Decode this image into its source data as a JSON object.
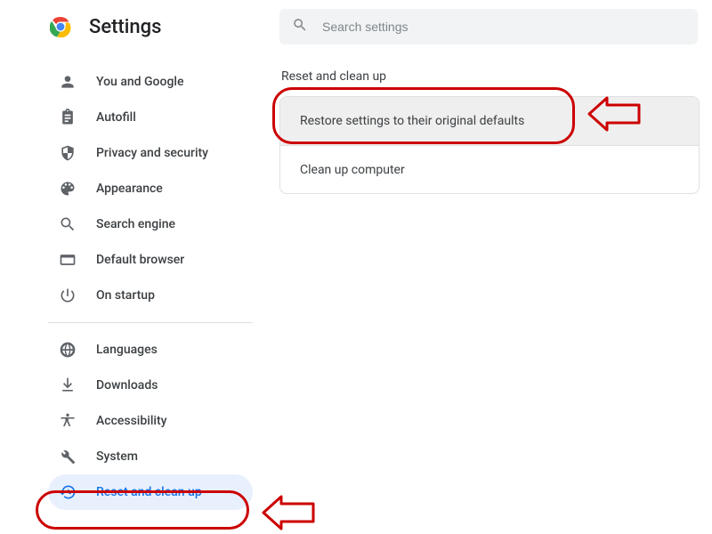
{
  "header": {
    "title": "Settings"
  },
  "search": {
    "placeholder": "Search settings",
    "value": ""
  },
  "sidebar": {
    "items": [
      {
        "id": "you-and-google",
        "label": "You and Google",
        "icon": "person-icon"
      },
      {
        "id": "autofill",
        "label": "Autofill",
        "icon": "clipboard-icon"
      },
      {
        "id": "privacy",
        "label": "Privacy and security",
        "icon": "shield-icon"
      },
      {
        "id": "appearance",
        "label": "Appearance",
        "icon": "palette-icon"
      },
      {
        "id": "search-engine",
        "label": "Search engine",
        "icon": "search-icon"
      },
      {
        "id": "default-browser",
        "label": "Default browser",
        "icon": "browser-icon"
      },
      {
        "id": "on-startup",
        "label": "On startup",
        "icon": "power-icon"
      },
      {
        "id": "languages",
        "label": "Languages",
        "icon": "globe-icon"
      },
      {
        "id": "downloads",
        "label": "Downloads",
        "icon": "download-icon"
      },
      {
        "id": "accessibility",
        "label": "Accessibility",
        "icon": "accessibility-icon"
      },
      {
        "id": "system",
        "label": "System",
        "icon": "wrench-icon"
      },
      {
        "id": "reset",
        "label": "Reset and clean up",
        "icon": "restore-icon",
        "selected": true
      }
    ]
  },
  "main": {
    "section_title": "Reset and clean up",
    "rows": [
      {
        "id": "restore-defaults",
        "label": "Restore settings to their original defaults",
        "highlighted": true
      },
      {
        "id": "clean-up",
        "label": "Clean up computer"
      }
    ]
  },
  "annotation_color": "#cc0000"
}
